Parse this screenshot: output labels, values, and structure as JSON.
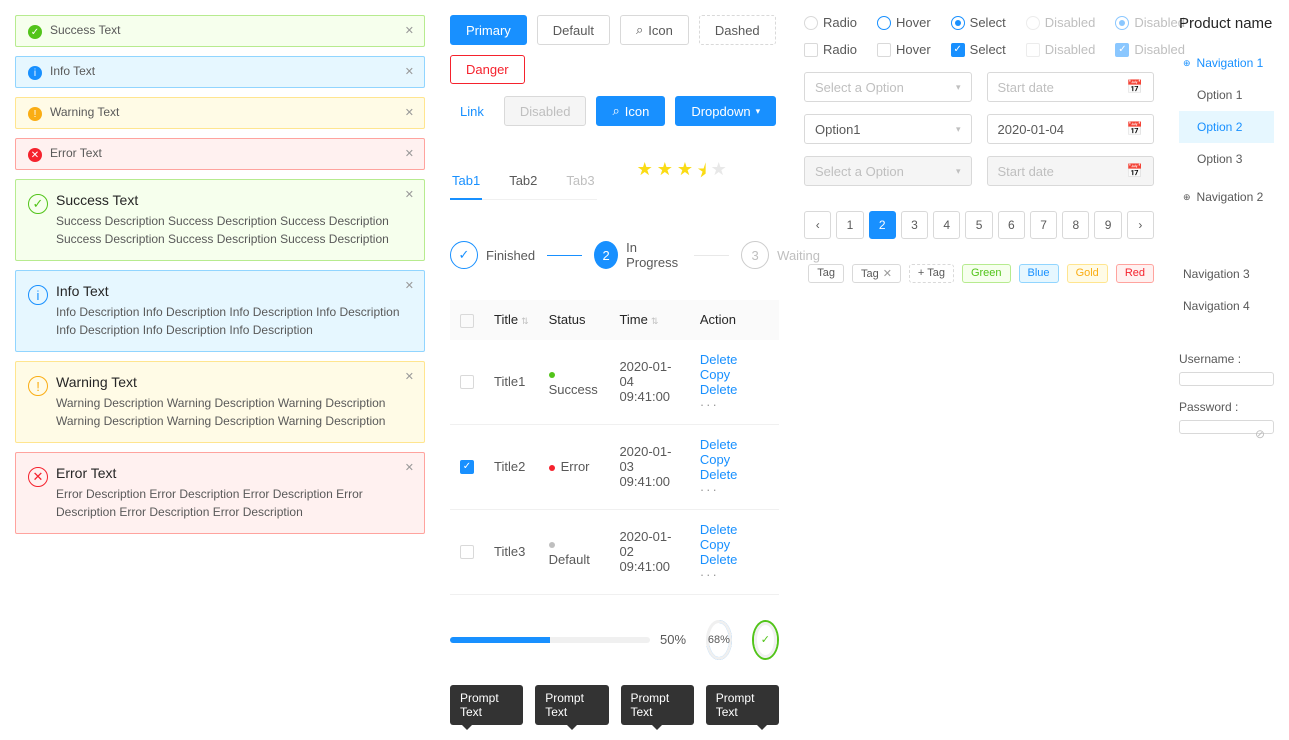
{
  "alerts_small": [
    {
      "type": "success",
      "text": "Success Text",
      "icon": "✓"
    },
    {
      "type": "info",
      "text": "Info Text",
      "icon": "i"
    },
    {
      "type": "warning",
      "text": "Warning Text",
      "icon": "!"
    },
    {
      "type": "error",
      "text": "Error Text",
      "icon": "✕"
    }
  ],
  "alerts_large": [
    {
      "type": "success",
      "title": "Success Text",
      "desc": "Success Description Success Description Success Description Success Description Success Description Success Description",
      "icon": "✓"
    },
    {
      "type": "info",
      "title": "Info Text",
      "desc": "Info Description Info Description Info Description Info Description Info Description Info Description Info Description",
      "icon": "i"
    },
    {
      "type": "warning",
      "title": "Warning Text",
      "desc": "Warning Description Warning Description Warning Description Warning Description Warning Description Warning Description",
      "icon": "!"
    },
    {
      "type": "error",
      "title": "Error Text",
      "desc": "Error Description Error Description Error Description Error Description Error Description Error Description",
      "icon": "✕"
    }
  ],
  "buttons_row1": {
    "primary": "Primary",
    "default": "Default",
    "icon": "Icon",
    "dashed": "Dashed",
    "danger": "Danger"
  },
  "buttons_row2": {
    "link": "Link",
    "disabled": "Disabled",
    "icon": "Icon",
    "dropdown": "Dropdown"
  },
  "tabs": [
    "Tab1",
    "Tab2",
    "Tab3"
  ],
  "stars_rating": 3.5,
  "steps": [
    {
      "label": "Finished",
      "state": "done",
      "icon": "✓"
    },
    {
      "label": "In Progress",
      "state": "active",
      "icon": "2"
    },
    {
      "label": "Waiting",
      "state": "wait",
      "icon": "3"
    }
  ],
  "table": {
    "headers": {
      "title": "Title",
      "status": "Status",
      "time": "Time",
      "action": "Action"
    },
    "rows": [
      {
        "checked": false,
        "title": "Title1",
        "status": "Success",
        "status_type": "success",
        "time": "2020-01-04  09:41:00"
      },
      {
        "checked": true,
        "title": "Title2",
        "status": "Error",
        "status_type": "error",
        "time": "2020-01-03  09:41:00"
      },
      {
        "checked": false,
        "title": "Title3",
        "status": "Default",
        "status_type": "default",
        "time": "2020-01-02  09:41:00"
      }
    ],
    "actions": {
      "delete": "Delete",
      "copy": "Copy"
    }
  },
  "progress": {
    "bar_pct": 50,
    "bar_label": "50%",
    "circle_pct": 68,
    "circle_label": "68%"
  },
  "tooltips": [
    "Prompt Text",
    "Prompt Text",
    "Prompt Text",
    "Prompt Text"
  ],
  "radios": {
    "row1": [
      {
        "label": "Radio",
        "state": ""
      },
      {
        "label": "Hover",
        "state": "hover"
      },
      {
        "label": "Select",
        "state": "on"
      },
      {
        "label": "Disabled",
        "state": "disabled"
      },
      {
        "label": "Disabled",
        "state": "disabled-on"
      }
    ],
    "row2": [
      {
        "label": "Radio",
        "state": ""
      },
      {
        "label": "Hover",
        "state": "hover"
      },
      {
        "label": "Select",
        "state": "on"
      },
      {
        "label": "Disabled",
        "state": "disabled"
      },
      {
        "label": "Disabled",
        "state": "disabled-on"
      }
    ]
  },
  "selects": {
    "placeholder": "Select a Option",
    "date_placeholder": "Start date",
    "value": "Option1",
    "date_value": "2020-01-04"
  },
  "pagination": {
    "pages": [
      "1",
      "2",
      "3",
      "4",
      "5",
      "6",
      "7",
      "8",
      "9"
    ],
    "active": 2
  },
  "tags": {
    "plain": [
      "Tag",
      "Tag"
    ],
    "add": "Tag",
    "colored": [
      {
        "label": "Green",
        "cls": "green"
      },
      {
        "label": "Blue",
        "cls": "blue"
      },
      {
        "label": "Gold",
        "cls": "gold"
      },
      {
        "label": "Red",
        "cls": "red"
      }
    ]
  },
  "nav": {
    "title": "Product name",
    "nav1": "Navigation 1",
    "options": [
      "Option 1",
      "Option 2",
      "Option 3"
    ],
    "option_selected": 1,
    "nav2": "Navigation 2",
    "nav3": "Navigation 3",
    "nav4": "Navigation 4"
  },
  "form": {
    "username_label": "Username :",
    "password_label": "Password :"
  }
}
